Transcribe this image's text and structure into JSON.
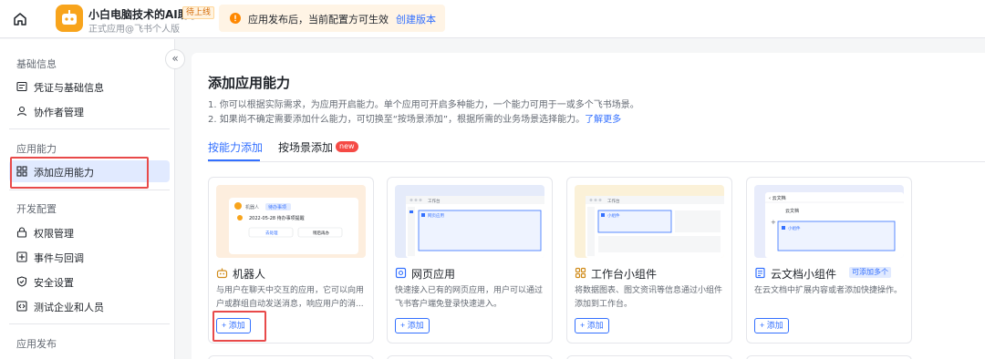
{
  "header": {
    "app_name": "小白电脑技术的AI助手",
    "status_badge": "待上线",
    "app_subtitle": "正式应用@飞书个人版",
    "notice_text": "应用发布后，当前配置方可生效",
    "notice_link": "创建版本"
  },
  "sidebar": {
    "sections": [
      {
        "title": "基础信息",
        "items": [
          {
            "label": "凭证与基础信息",
            "icon": "credential-icon"
          },
          {
            "label": "协作者管理",
            "icon": "user-icon"
          }
        ]
      },
      {
        "title": "应用能力",
        "items": [
          {
            "label": "添加应用能力",
            "icon": "grid-icon",
            "active": true
          }
        ]
      },
      {
        "title": "开发配置",
        "items": [
          {
            "label": "权限管理",
            "icon": "lock-icon"
          },
          {
            "label": "事件与回调",
            "icon": "event-icon"
          },
          {
            "label": "安全设置",
            "icon": "shield-icon"
          },
          {
            "label": "测试企业和人员",
            "icon": "code-icon"
          }
        ]
      },
      {
        "title": "应用发布",
        "items": []
      }
    ],
    "collapse_glyph": "«"
  },
  "main": {
    "title": "添加应用能力",
    "desc1": "1. 你可以根据实际需求，为应用开启能力。单个应用可开启多种能力，一个能力可用于一或多个飞书场景。",
    "desc2": "2. 如果尚不确定需要添加什么能力，可切换至“按场景添加”，根据所需的业务场景选择能力。",
    "desc2_link": "了解更多",
    "tabs": [
      {
        "label": "按能力添加",
        "active": true
      },
      {
        "label": "按场景添加",
        "badge": "new"
      }
    ],
    "cards": [
      {
        "title": "机器人",
        "icon": "robot-icon",
        "desc": "与用户在聊天中交互的应用，它可以向用户或群组自动发送消息，响应用户的消...",
        "add_label": "+ 添加",
        "thumb": {
          "chat_name": "机器人",
          "chat_tag": "待办事项",
          "reminder": "2022-05-28 待办事项提醒",
          "btn1": "去处理",
          "btn2": "稍后再办"
        }
      },
      {
        "title": "网页应用",
        "icon": "web-icon",
        "desc": "快速接入已有的网页应用，用户可以通过飞书客户端免登录快速进入。",
        "add_label": "+ 添加",
        "thumb": {
          "tab": "工作台",
          "item": "网页应用"
        }
      },
      {
        "title": "工作台小组件",
        "icon": "widget-icon",
        "desc": "将数据图表、图文资讯等信息通过小组件添加到工作台。",
        "add_label": "+ 添加",
        "thumb": {
          "tab": "工作台",
          "item": "小组件"
        }
      },
      {
        "title": "云文档小组件",
        "icon": "doc-icon",
        "desc": "在云文档中扩展内容或者添加快捷操作。",
        "add_label": "+ 添加",
        "tag": "可添加多个",
        "thumb": {
          "header": "云文档",
          "doc": "云文档",
          "item": "小组件"
        }
      }
    ]
  },
  "colors": {
    "accent": "#3370ff",
    "highlight_box": "#e84a4a",
    "active_bg": "#e1eaff"
  }
}
